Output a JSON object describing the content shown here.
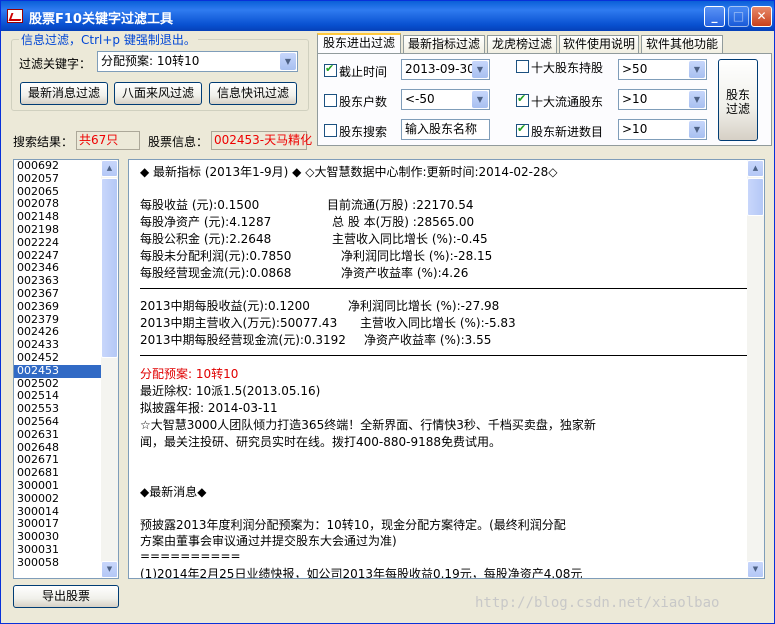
{
  "window": {
    "title": "股票F10关键字过滤工具",
    "min": "_",
    "max": "□",
    "close": "✕"
  },
  "filter": {
    "group_title": "信息过滤，Ctrl+p 键强制退出。",
    "keyword_label": "过滤关键字：",
    "keyword_value": "分配预案: 10转10",
    "btn_news": "最新消息过滤",
    "btn_wind": "八面来风过滤",
    "btn_flash": "信息快讯过滤",
    "result_label": "搜索结果：",
    "result_value": "共67只",
    "stock_label": "股票信息：",
    "stock_value": "002453-天马精化"
  },
  "tabs": [
    "股东进出过滤",
    "最新指标过滤",
    "龙虎榜过滤",
    "软件使用说明",
    "软件其他功能"
  ],
  "holder_panel": {
    "end_time_label": "截止时间",
    "end_time_checked": true,
    "end_time_value": "2013-09-30",
    "holder_count_label": "股东户数",
    "holder_count_checked": false,
    "holder_count_value": "<-50",
    "holder_search_label": "股东搜索",
    "holder_search_checked": false,
    "holder_search_placeholder": "输入股东名称",
    "top10_label": "十大股东持股",
    "top10_checked": false,
    "top10_value": ">50",
    "top10_float_label": "十大流通股东",
    "top10_float_checked": true,
    "top10_float_value": ">10",
    "new_holder_label": "股东新进数目",
    "new_holder_checked": true,
    "new_holder_value": ">10",
    "filter_btn": "股东\n过滤"
  },
  "stock_list": [
    "000692",
    "002057",
    "002065",
    "002078",
    "002148",
    "002198",
    "002224",
    "002247",
    "002346",
    "002363",
    "002367",
    "002369",
    "002379",
    "002426",
    "002433",
    "002452",
    "002453",
    "002502",
    "002514",
    "002553",
    "002564",
    "002631",
    "002648",
    "002671",
    "002681",
    "300001",
    "300002",
    "300014",
    "300017",
    "300030",
    "300031",
    "300058"
  ],
  "selected_stock": "002453",
  "export_btn": "导出股票",
  "content": {
    "header": "◆  最新指标 (2013年1-9月)  ◆   ◇大智慧数据中心制作:更新时间:2014-02-28◇",
    "r1a": "每股收益       (元):0.1500",
    "r1b": "目前流通(万股)       :22170.54",
    "r2a": "每股净资产     (元):4.1287",
    "r2b": "总 股 本(万股)       :28565.00",
    "r3a": "每股公积金     (元):2.2648",
    "r3b": "主营收入同比增长     (%):-0.45",
    "r4a": "每股未分配利润(元):0.7850",
    "r4b": "净利润同比增长       (%):-28.15",
    "r5a": "每股经营现金流(元):0.0868",
    "r5b": "净资产收益率         (%):4.26",
    "m1a": "2013中期每股收益(元):0.1200",
    "m1b": "净利润同比增长       (%):-27.98",
    "m2a": "2013中期主营收入(万元):50077.43",
    "m2b": "主营收入同比增长     (%):-5.83",
    "m3a": "2013中期每股经营现金流(元):0.3192",
    "m3b": "净资产收益率         (%):3.55",
    "plan": "分配预案: 10转10",
    "exright": "最近除权: 10派1.5(2013.05.16)",
    "report": "拟披露年报: 2014-03-11",
    "ad1": "☆大智慧3000人团队倾力打造365终端！全新界面、行情快3秒、千档买卖盘，独家新",
    "ad2": "闻，最关注投研、研究员实时在线。拨打400-880-9188免费试用。",
    "news_title": "◆最新消息◆",
    "news1": "         预披露2013年度利润分配预案为：10转10，现金分配方案待定。(最终利润分配",
    "news2": " 方案由董事会审议通过并提交股东大会通过为准)",
    "sep": "     ==========",
    "news3": "     (1)2014年2月25日业绩快报，如公司2013年每股收益0.19元，每股净资产4.08元"
  },
  "watermark": "http://blog.csdn.net/xiaolbao",
  "colors": {
    "title_bar": "#0a5fd8",
    "highlight_red": "#e00000",
    "selection": "#316ac5"
  }
}
